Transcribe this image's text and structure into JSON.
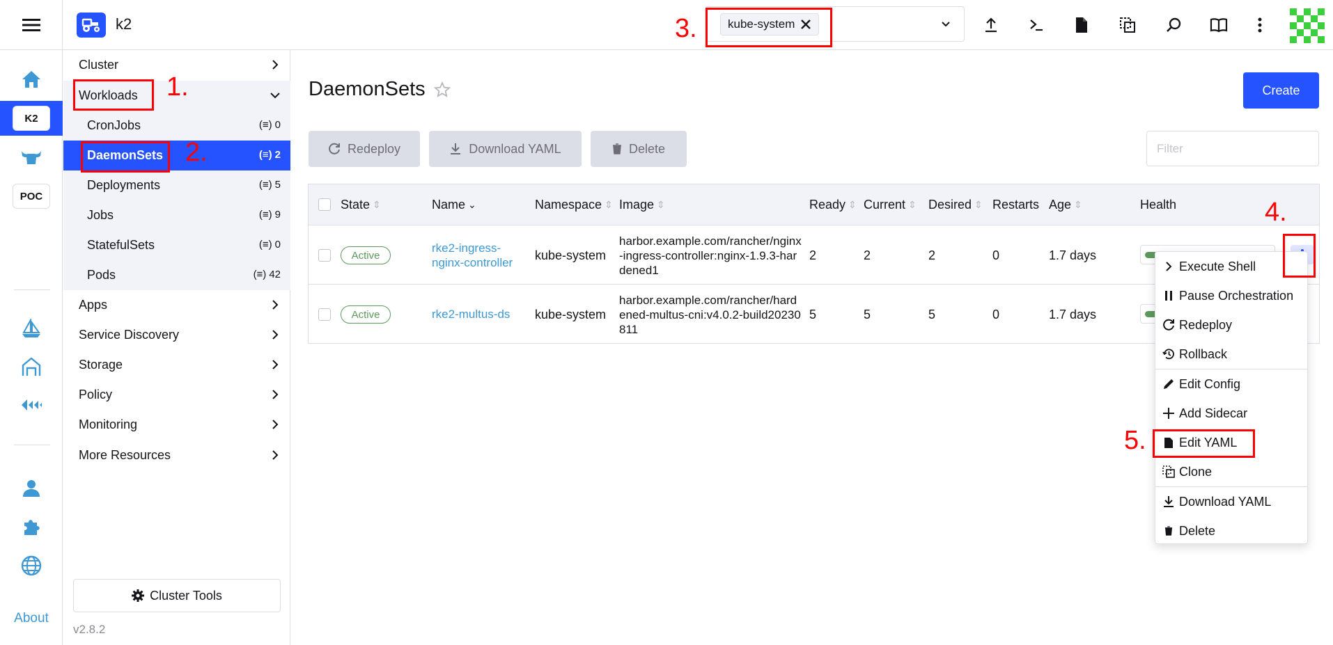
{
  "header": {
    "cluster_name": "k2",
    "namespace_chip": "kube-system",
    "icons": [
      "hamburger-icon",
      "upload-icon",
      "terminal-icon",
      "file-icon",
      "copy-icon",
      "search-icon",
      "book-icon",
      "more-vertical-icon",
      "avatar"
    ]
  },
  "rail": {
    "items": [
      {
        "name": "home-icon"
      },
      {
        "badge": "K2",
        "active": true
      },
      {
        "name": "bull-icon"
      },
      {
        "badge": "POC"
      },
      {
        "name": "sailboat-icon"
      },
      {
        "name": "building-icon"
      },
      {
        "name": "network-icon"
      },
      {
        "name": "user-icon"
      },
      {
        "name": "puzzle-icon"
      },
      {
        "name": "globe-icon"
      }
    ],
    "about": "About"
  },
  "nav": {
    "cluster": "Cluster",
    "workloads": "Workloads",
    "sub": [
      {
        "label": "CronJobs",
        "count": "0"
      },
      {
        "label": "DaemonSets",
        "count": "2"
      },
      {
        "label": "Deployments",
        "count": "5"
      },
      {
        "label": "Jobs",
        "count": "9"
      },
      {
        "label": "StatefulSets",
        "count": "0"
      },
      {
        "label": "Pods",
        "count": "42"
      }
    ],
    "groups": [
      "Apps",
      "Service Discovery",
      "Storage",
      "Policy",
      "Monitoring",
      "More Resources"
    ],
    "cluster_tools": "Cluster Tools",
    "version": "v2.8.2"
  },
  "main": {
    "title": "DaemonSets",
    "create": "Create",
    "bulk": {
      "redeploy": "Redeploy",
      "download": "Download YAML",
      "delete": "Delete"
    },
    "filter_placeholder": "Filter",
    "columns": {
      "state": "State",
      "name": "Name",
      "namespace": "Namespace",
      "image": "Image",
      "ready": "Ready",
      "current": "Current",
      "desired": "Desired",
      "restarts": "Restarts",
      "age": "Age",
      "health": "Health"
    },
    "rows": [
      {
        "state": "Active",
        "name_line1": "rke2-ingress-",
        "name_line2": "nginx-controller",
        "namespace": "kube-system",
        "image": "harbor.example.com/rancher/nginx-ingress-controller:nginx-1.9.3-hardened1",
        "ready": "2",
        "current": "2",
        "desired": "2",
        "restarts": "0",
        "age": "1.7 days",
        "health": 0.12
      },
      {
        "state": "Active",
        "name_line1": "rke2-multus-ds",
        "name_line2": "",
        "namespace": "kube-system",
        "image": "harbor.example.com/rancher/hardened-multus-cni:v4.0.2-build20230811",
        "ready": "5",
        "current": "5",
        "desired": "5",
        "restarts": "0",
        "age": "1.7 days",
        "health": 0.12
      }
    ]
  },
  "menu": {
    "items": [
      {
        "label": "Execute Shell",
        "icon": "chevron-right-icon"
      },
      {
        "label": "Pause Orchestration",
        "icon": "pause-icon"
      },
      {
        "label": "Redeploy",
        "icon": "refresh-icon"
      },
      {
        "label": "Rollback",
        "icon": "history-icon"
      },
      {
        "label": "Edit Config",
        "icon": "pencil-icon"
      },
      {
        "label": "Add Sidecar",
        "icon": "plus-icon"
      },
      {
        "label": "Edit YAML",
        "icon": "file-icon"
      },
      {
        "label": "Clone",
        "icon": "copy-icon"
      },
      {
        "label": "Download YAML",
        "icon": "download-icon"
      },
      {
        "label": "Delete",
        "icon": "trash-icon"
      }
    ]
  },
  "annotations": {
    "n1": "1.",
    "n2": "2.",
    "n3": "3.",
    "n4": "4.",
    "n5": "5."
  },
  "colors": {
    "accent": "#2453ff",
    "link": "#3d98d3",
    "success": "#5d995d",
    "annotation": "#ff0000"
  }
}
